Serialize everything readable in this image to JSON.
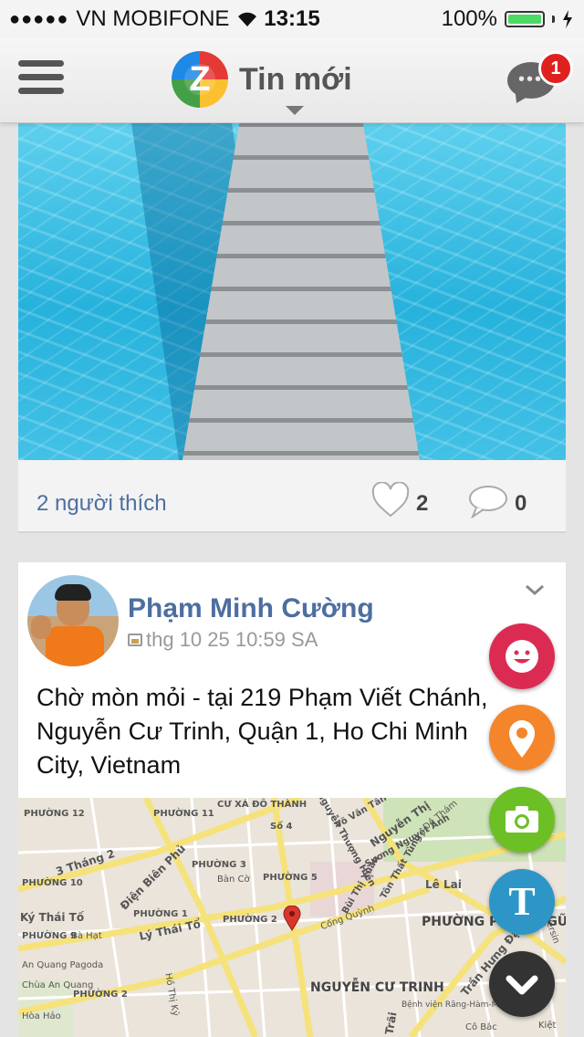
{
  "status_bar": {
    "signal_dots": "●●●●●",
    "carrier": "VN MOBIFONE",
    "time": "13:15",
    "battery_percent": "100%",
    "battery_level": 1.0
  },
  "nav": {
    "logo_letter": "Z",
    "title": "Tin mới",
    "notification_count": "1",
    "menu_icon": "hamburger-icon",
    "chat_icon": "chat-bubble-icon"
  },
  "post1": {
    "likes_text": "2 người thích",
    "like_count": "2",
    "comment_count": "0"
  },
  "post2": {
    "author": "Phạm Minh Cường",
    "time": "thg 10 25 10:59 SA",
    "text": "Chờ mòn mỏi - tại 219 Phạm Viết Chánh, Nguyễn Cư Trinh, Quận 1, Ho Chi Minh City, Vietnam",
    "map_labels": {
      "l1": "PHƯỜNG 12",
      "l2": "PHƯỜNG 11",
      "l3": "CƯ XÁ ĐÔ THÀNH",
      "l4": "Số 4",
      "l5": "Nguyễn Thượng Hiền",
      "l6": "Võ Văn Tần",
      "l7": "Sương Nguyệt Ánh",
      "l8": "Nguyễn Thị",
      "l9": "3 Tháng 2",
      "l10": "Điện Biên Phủ",
      "l11": "PHƯỜNG 3",
      "l12": "Bàn Cờ",
      "l13": "PHƯỜNG 5",
      "l14": "Bùi Thị Xuân",
      "l15": "Tôn Thất Tùng",
      "l16": "Lê Lai",
      "l17": "PHƯỜNG 10",
      "l18": "Lý Thái Tổ",
      "l19": "PHƯỜNG 1",
      "l20": "PHƯỜNG 2",
      "l21": "Cống Quỳnh",
      "l22": "PHƯỜNG PHẠM NGŨ LÃO",
      "l23": "PHƯỜNG 9",
      "l24": "Bà Hạt",
      "l25": "An Quang Pagoda",
      "l26": "Chùa An Quang",
      "l27": "Hồ Thị Kỷ",
      "l28": "PHƯỜNG 2",
      "l29": "NGUYỄN CƯ TRINH",
      "l30": "Bệnh viện Răng-Hàm-Mặt",
      "l31": "Trần Hưng Đạo",
      "l32": "Cô Bắc",
      "l33": "Hòa Hảo",
      "l34": "Yersin",
      "l35": "Đề Thám",
      "l36": "Trãi",
      "l37": "Kiệt",
      "l38": "Ký Thái Tố"
    }
  },
  "fabs": {
    "sticker": "smiley-icon",
    "location": "location-pin-icon",
    "photo": "camera-icon",
    "text_letter": "T",
    "collapse": "chevron-down-icon"
  },
  "colors": {
    "link_blue": "#4d6ea0",
    "badge_red": "#e0201c",
    "sticker_pink": "#dc2b52",
    "location_orange": "#f4852a",
    "photo_green": "#6cc026",
    "text_blue": "#2d96c7",
    "collapse_dark": "#333333"
  }
}
